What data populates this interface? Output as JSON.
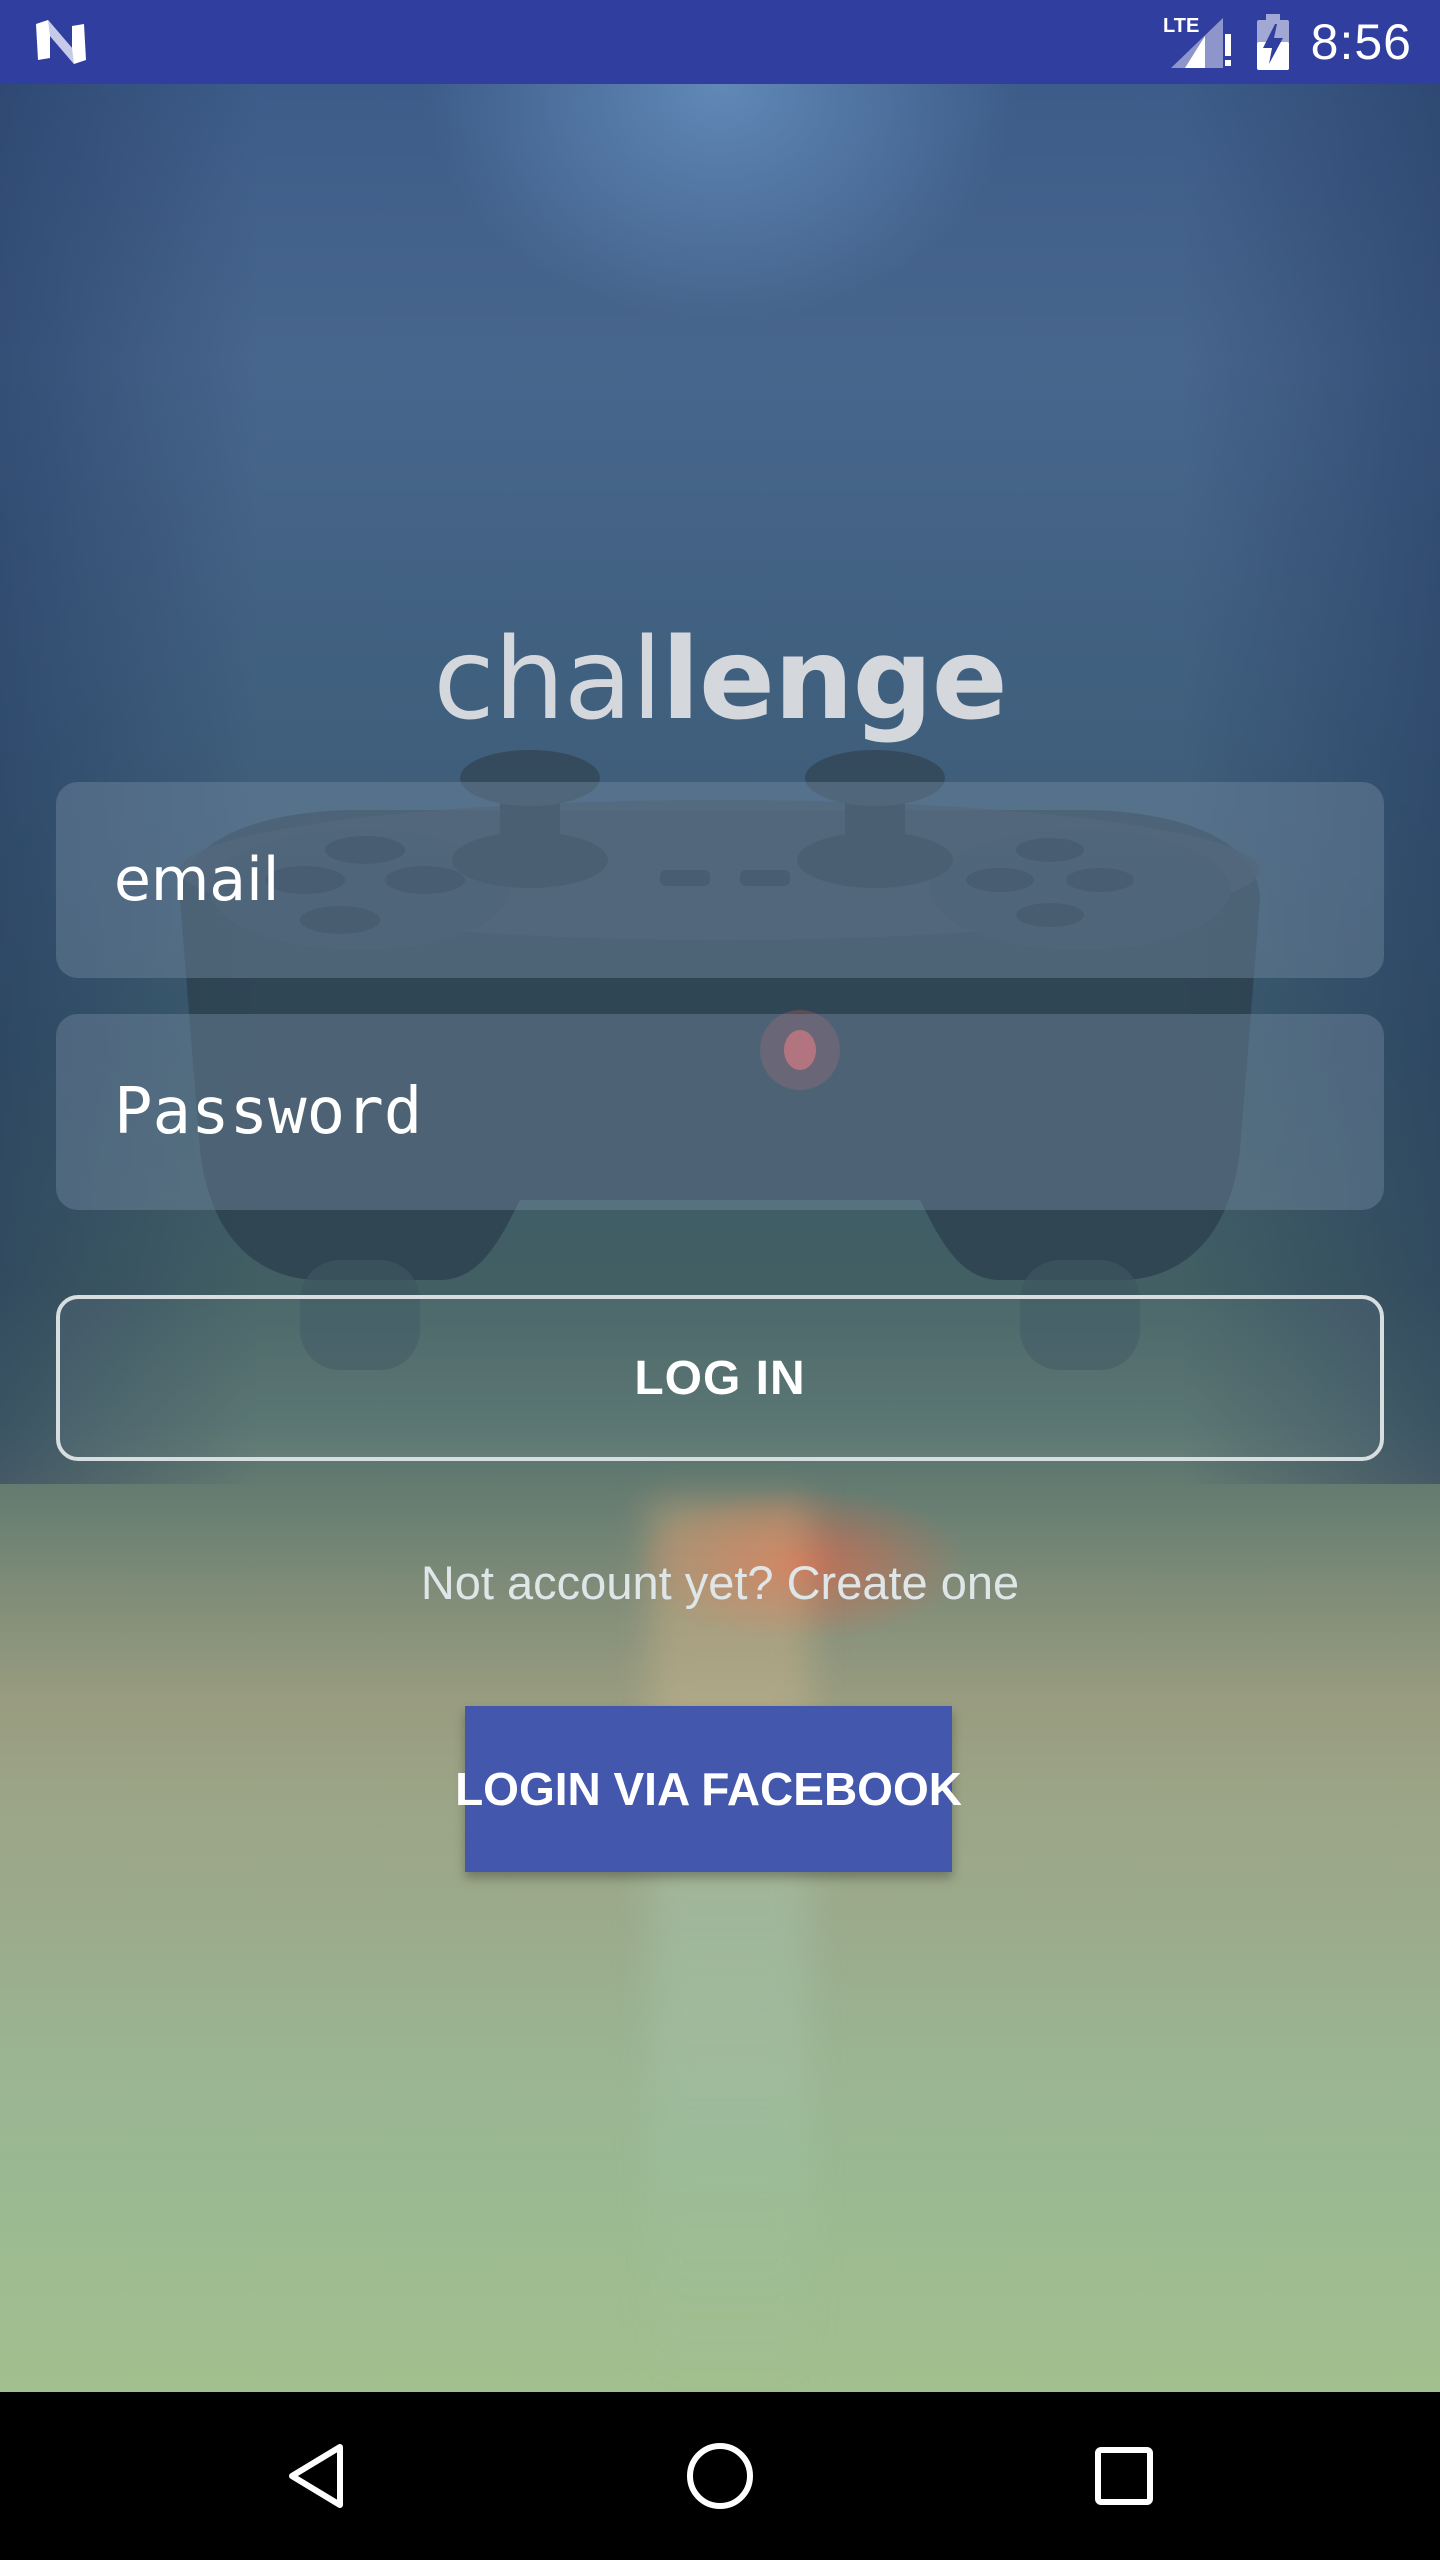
{
  "status_bar": {
    "time": "8:56",
    "network_label": "LTE",
    "background_color": "#303F9F",
    "icons": [
      "android-n-icon",
      "cellular-signal-icon",
      "battery-charging-icon"
    ]
  },
  "app": {
    "logo_light": "chal",
    "logo_bold": "lenge"
  },
  "form": {
    "email_placeholder": "email",
    "password_placeholder": "Password",
    "login_label": "LOG IN",
    "signup_text": "Not account yet? Create one",
    "facebook_label": "LOGIN VIA FACEBOOK",
    "facebook_color": "#4357AD"
  },
  "nav_bar": {
    "icons": [
      "back-icon",
      "home-icon",
      "recents-icon"
    ]
  }
}
